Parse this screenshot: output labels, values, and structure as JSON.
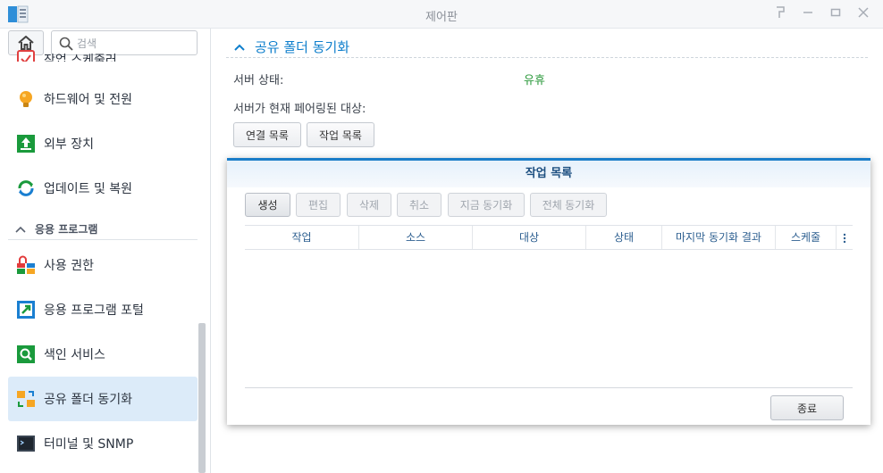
{
  "window": {
    "title": "제어판"
  },
  "sidebar": {
    "search_placeholder": "검색",
    "partial_item_label": "작업 스케줄러",
    "items": [
      {
        "label": "하드웨어 및 전원",
        "icon": "bulb-icon"
      },
      {
        "label": "외부 장치",
        "icon": "external-device-icon"
      },
      {
        "label": "업데이트 및 복원",
        "icon": "update-restore-icon"
      }
    ],
    "section_label": "응용 프로그램",
    "app_items": [
      {
        "label": "사용 권한",
        "icon": "privileges-icon"
      },
      {
        "label": "응용 프로그램 포털",
        "icon": "app-portal-icon"
      },
      {
        "label": "색인 서비스",
        "icon": "indexing-service-icon"
      },
      {
        "label": "공유 폴더 동기화",
        "icon": "shared-folder-sync-icon",
        "active": true
      },
      {
        "label": "터미널 및 SNMP",
        "icon": "terminal-icon"
      }
    ]
  },
  "main": {
    "section_title": "공유 폴더 동기화",
    "server_status_label": "서버 상태:",
    "server_status_value": "유휴",
    "paired_label": "서버가 현재 페어링된 대상:",
    "buttons": {
      "connection_list": "연결 목록",
      "task_list": "작업 목록"
    }
  },
  "modal": {
    "title": "작업 목록",
    "toolbar": {
      "create": "생성",
      "edit": "편집",
      "delete": "삭제",
      "cancel": "취소",
      "sync_now": "지금 동기화",
      "full_sync": "전체 동기화"
    },
    "columns": [
      "작업",
      "소스",
      "대상",
      "상태",
      "마지막 동기화 결과",
      "스케줄"
    ],
    "rows": [],
    "close_label": "종료"
  },
  "colors": {
    "accent": "#0f7fcc",
    "status_ok": "#2e9a3e",
    "active_bg": "#dcebf9"
  }
}
